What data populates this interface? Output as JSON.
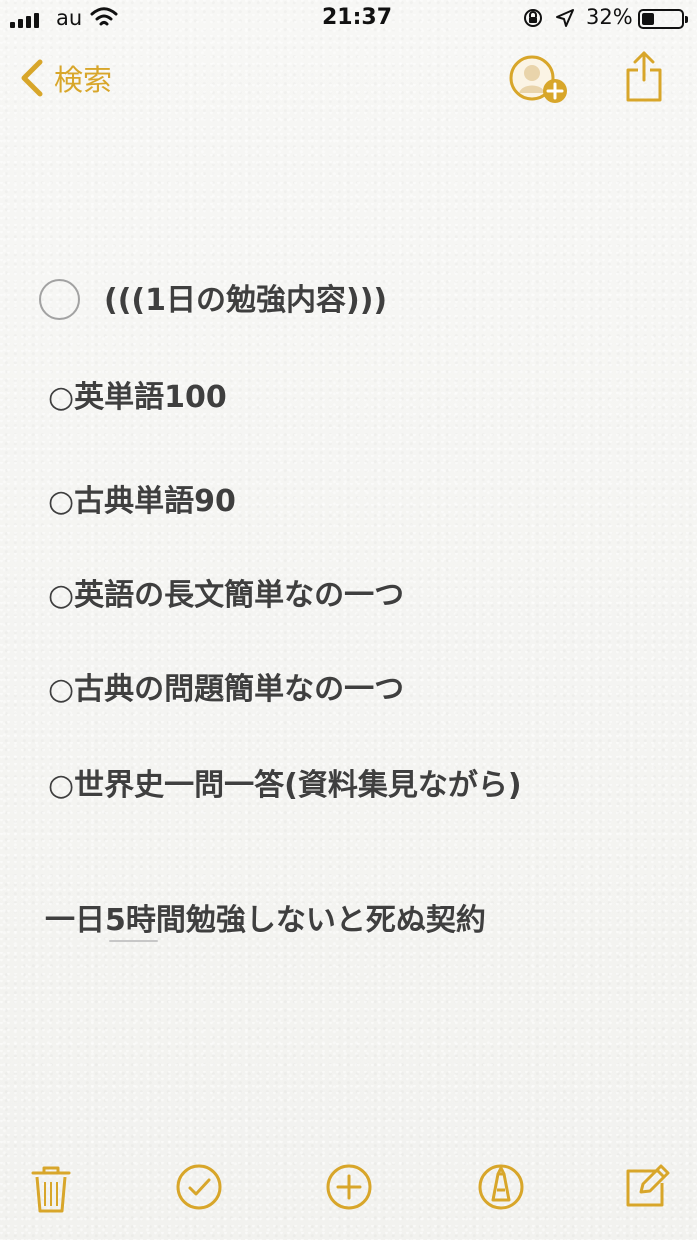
{
  "status_bar": {
    "carrier": "au",
    "time": "21:37",
    "battery_percent": "32%",
    "signal_bars": 4,
    "battery_level": 0.32,
    "icons": [
      "signal-icon",
      "wifi-icon",
      "rotation-lock-icon",
      "location-icon",
      "battery-icon"
    ]
  },
  "navigation": {
    "back_label": "検索",
    "icons": [
      "back-chevron-icon",
      "add-contact-icon",
      "share-icon"
    ]
  },
  "note": {
    "lines": [
      "(((1日の勉強内容)))",
      "○英単語100",
      "○古典単語90",
      "○英語の長文簡単なの一つ",
      "○古典の問題簡単なの一つ",
      "○世界史一問一答(資料集見ながら)",
      "一日5時間勉強しないと死ぬ契約"
    ]
  },
  "toolbar": {
    "icons": [
      "trash-icon",
      "checklist-icon",
      "add-icon",
      "markup-icon",
      "compose-icon"
    ]
  },
  "colors": {
    "accent": "#D8A62A",
    "text": "#3F3F3F",
    "background": "#F4F4F2"
  }
}
